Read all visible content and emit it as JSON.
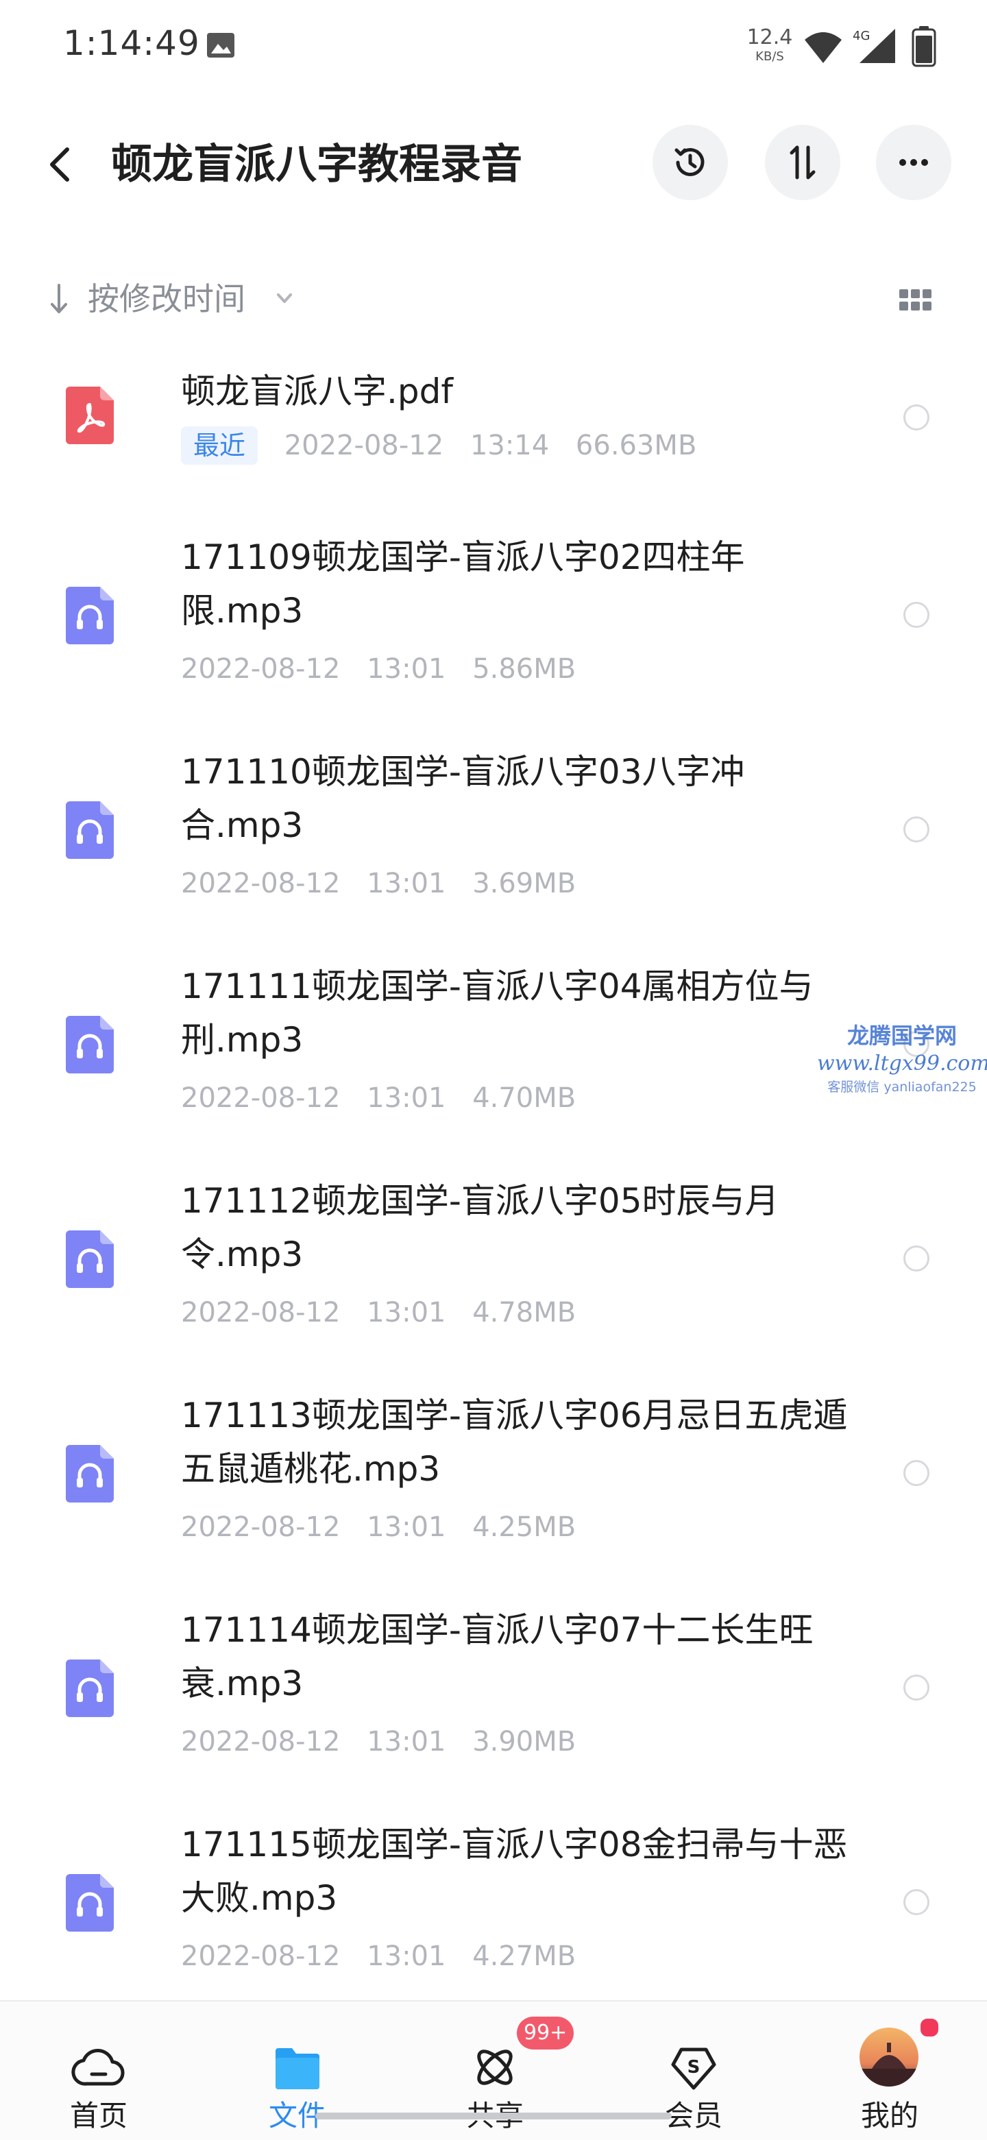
{
  "status_bar": {
    "time": "1:14:49",
    "net_speed_value": "12.4",
    "net_speed_unit": "KB/S",
    "network_type": "4G"
  },
  "header": {
    "title": "顿龙盲派八字教程录音"
  },
  "sort": {
    "label": "按修改时间"
  },
  "files": [
    {
      "name": "顿龙盲派八字.pdf",
      "type": "pdf",
      "badge": "最近",
      "date": "2022-08-12",
      "time": "13:14",
      "size": "66.63MB"
    },
    {
      "name": "171109顿龙国学-盲派八字02四柱年限.mp3",
      "type": "audio",
      "date": "2022-08-12",
      "time": "13:01",
      "size": "5.86MB"
    },
    {
      "name": "171110顿龙国学-盲派八字03八字冲合.mp3",
      "type": "audio",
      "date": "2022-08-12",
      "time": "13:01",
      "size": "3.69MB"
    },
    {
      "name": "171111顿龙国学-盲派八字04属相方位与刑.mp3",
      "type": "audio",
      "date": "2022-08-12",
      "time": "13:01",
      "size": "4.70MB"
    },
    {
      "name": "171112顿龙国学-盲派八字05时辰与月令.mp3",
      "type": "audio",
      "date": "2022-08-12",
      "time": "13:01",
      "size": "4.78MB"
    },
    {
      "name": "171113顿龙国学-盲派八字06月忌日五虎遁五鼠遁桃花.mp3",
      "type": "audio",
      "date": "2022-08-12",
      "time": "13:01",
      "size": "4.25MB"
    },
    {
      "name": "171114顿龙国学-盲派八字07十二长生旺衰.mp3",
      "type": "audio",
      "date": "2022-08-12",
      "time": "13:01",
      "size": "3.90MB"
    },
    {
      "name": "171115顿龙国学-盲派八字08金扫帚与十恶大败.mp3",
      "type": "audio",
      "date": "2022-08-12",
      "time": "13:01",
      "size": "4.27MB"
    }
  ],
  "watermark": {
    "line1": "龙腾国学网",
    "line2": "www.ltgx99.com",
    "line3": "客服微信 yanliaofan225"
  },
  "nav": [
    {
      "label": "首页",
      "icon": "home-cloud-icon",
      "active": false
    },
    {
      "label": "文件",
      "icon": "folder-icon",
      "active": true
    },
    {
      "label": "共享",
      "icon": "share-atom-icon",
      "active": false,
      "badge": "99+"
    },
    {
      "label": "会员",
      "icon": "member-diamond-icon",
      "active": false
    },
    {
      "label": "我的",
      "icon": "avatar",
      "active": false
    }
  ],
  "colors": {
    "accent": "#2e8bf0",
    "pdf": "#ee5a64",
    "audio": "#7e84f5",
    "badge": "#f25a6b"
  }
}
